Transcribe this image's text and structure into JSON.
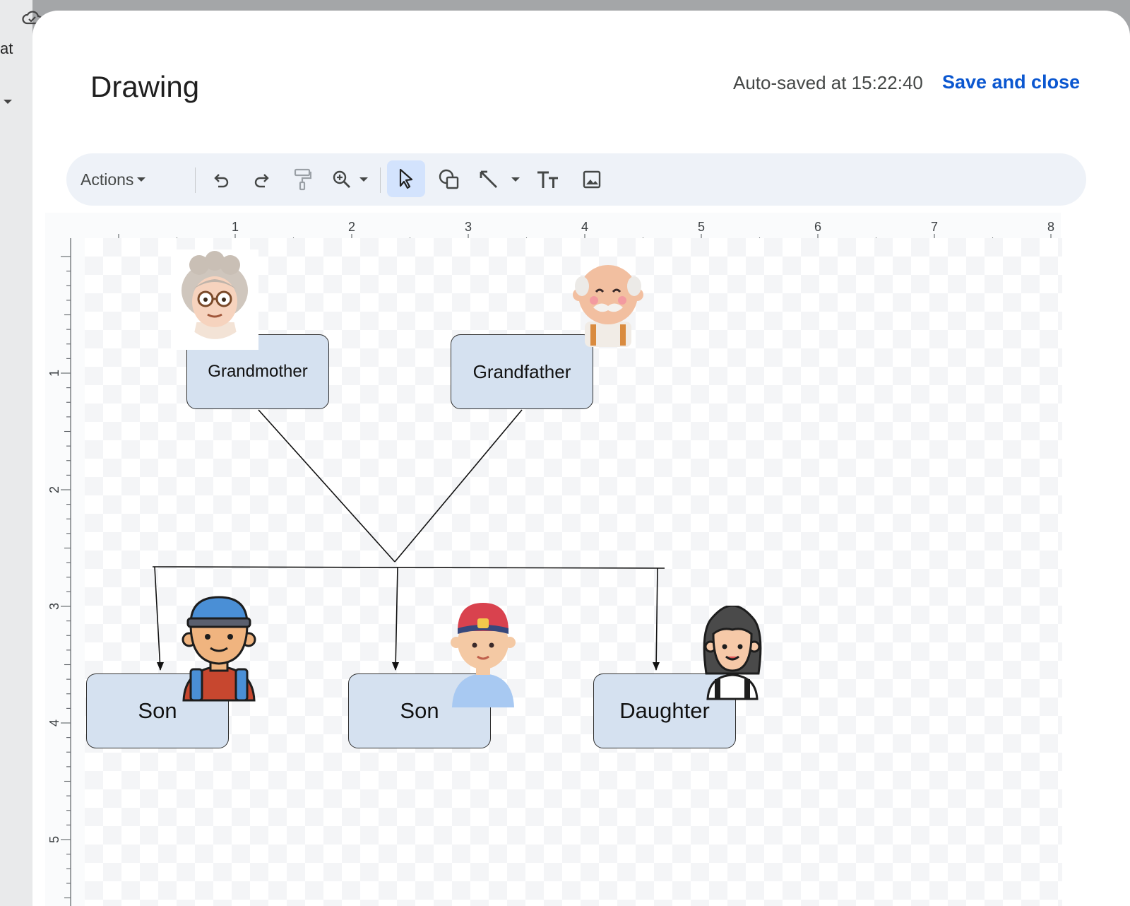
{
  "background_doc": {
    "fragment_text": "at"
  },
  "dialog": {
    "title": "Drawing",
    "autosave": "Auto-saved at 15:22:40",
    "save_close": "Save and close"
  },
  "toolbar": {
    "actions_label": "Actions",
    "icons": [
      "undo-icon",
      "redo-icon",
      "paint-format-icon",
      "zoom-icon",
      "select-icon",
      "shape-icon",
      "line-icon",
      "text-box-icon",
      "image-icon"
    ]
  },
  "rulers": {
    "horizontal": [
      "1",
      "2",
      "3",
      "4",
      "5",
      "6",
      "7",
      "8"
    ],
    "vertical": [
      "1",
      "2",
      "3",
      "4",
      "5"
    ]
  },
  "diagram": {
    "nodes": [
      {
        "id": "grandmother",
        "label": "Grandmother"
      },
      {
        "id": "grandfather",
        "label": "Grandfather"
      },
      {
        "id": "son1",
        "label": "Son"
      },
      {
        "id": "son2",
        "label": "Son"
      },
      {
        "id": "daughter",
        "label": "Daughter"
      }
    ],
    "colors": {
      "box_fill": "#d5e1f0",
      "box_border": "#2f2f2f",
      "accent": "#0b57d0"
    }
  }
}
